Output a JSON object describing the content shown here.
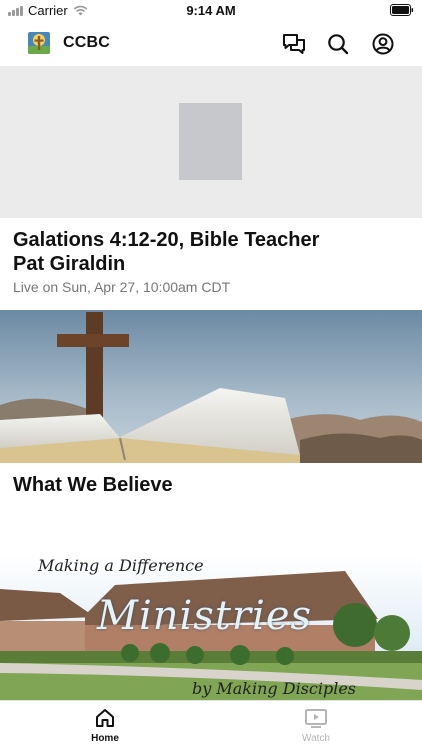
{
  "status_bar": {
    "carrier": "Carrier",
    "time": "9:14 AM"
  },
  "header": {
    "title": "CCBC",
    "icons": [
      "chat-bubbles-icon",
      "search-icon",
      "account-icon"
    ]
  },
  "feed": {
    "card1": {
      "title": "Galations 4:12-20, Bible Teacher Pat Giraldin",
      "subtitle": "Live on Sun, Apr 27, 10:00am CDT"
    },
    "card2": {
      "title": "What We Believe"
    },
    "card3": {
      "line_top": "Making a Difference",
      "line_main": "Ministries",
      "line_bottom": "by Making Disciples"
    }
  },
  "tabs": [
    {
      "label": "Home",
      "active": true,
      "icon": "home-icon"
    },
    {
      "label": "Watch",
      "active": false,
      "icon": "play-screen-icon"
    }
  ],
  "colors": {
    "active": "#111111",
    "inactive": "#b5b5b5",
    "placeholder_bg": "#ebebec",
    "placeholder_thumb": "#c7c8cc"
  }
}
